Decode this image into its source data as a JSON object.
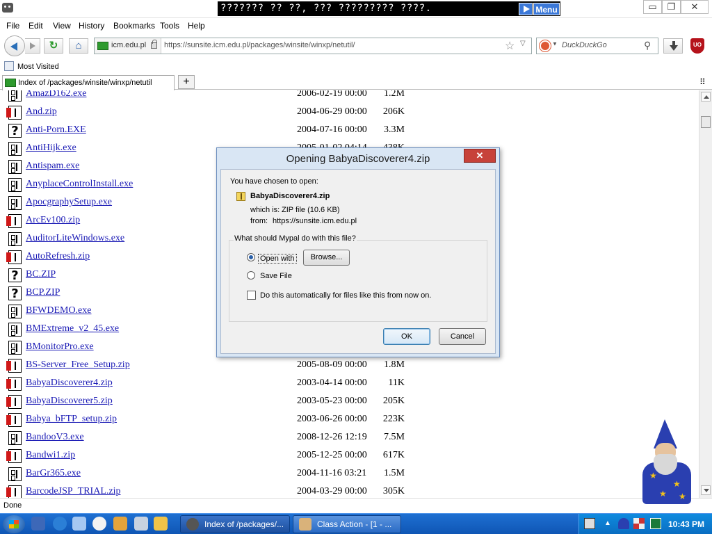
{
  "window": {
    "title": "??????? ?? ??, ??? ????????? ????.",
    "menu_button": "Menu",
    "min_glyph": "▭",
    "max_glyph": "❐",
    "close_glyph": "✕"
  },
  "menubar": {
    "items": [
      "File",
      "Edit",
      "View",
      "History",
      "Bookmarks",
      "Tools",
      "Help"
    ]
  },
  "navbar": {
    "site_domain": "icm.edu.pl",
    "url": "https://sunsite.icm.edu.pl/packages/winsite/winxp/netutil/",
    "search_placeholder": "DuckDuckGo",
    "reload_glyph": "↻",
    "home_glyph": "⌂",
    "star_glyph": "☆",
    "dropmarker_glyph": "▽",
    "search_go_glyph": "⚲",
    "ublock_label": "UO"
  },
  "bookmarks": {
    "most_visited": "Most Visited"
  },
  "tabs": {
    "active_title": "Index of /packages/winsite/winxp/netutil",
    "new_tab_glyph": "+",
    "list_glyph": "⠿"
  },
  "listing": {
    "files": [
      {
        "icon": "bin",
        "name": "AmazD162.exe",
        "date": "2006-02-19 00:00",
        "size": "1.2M"
      },
      {
        "icon": "zip",
        "name": "And.zip",
        "date": "2004-06-29 00:00",
        "size": "206K"
      },
      {
        "icon": "unk",
        "name": "Anti-Porn.EXE",
        "date": "2004-07-16 00:00",
        "size": "3.3M"
      },
      {
        "icon": "bin",
        "name": "AntiHijk.exe",
        "date": "2005-01-02 04:14",
        "size": "438K"
      },
      {
        "icon": "bin",
        "name": "Antispam.exe",
        "date": "",
        "size": ""
      },
      {
        "icon": "bin",
        "name": "AnyplaceControlInstall.exe",
        "date": "",
        "size": ""
      },
      {
        "icon": "bin",
        "name": "ApocgraphySetup.exe",
        "date": "",
        "size": ""
      },
      {
        "icon": "zip",
        "name": "ArcEv100.zip",
        "date": "",
        "size": ""
      },
      {
        "icon": "bin",
        "name": "AuditorLiteWindows.exe",
        "date": "",
        "size": ""
      },
      {
        "icon": "zip",
        "name": "AutoRefresh.zip",
        "date": "",
        "size": ""
      },
      {
        "icon": "unk",
        "name": "BC.ZIP",
        "date": "",
        "size": ""
      },
      {
        "icon": "unk",
        "name": "BCP.ZIP",
        "date": "",
        "size": ""
      },
      {
        "icon": "bin",
        "name": "BFWDEMO.exe",
        "date": "",
        "size": ""
      },
      {
        "icon": "bin",
        "name": "BMExtreme_v2_45.exe",
        "date": "",
        "size": ""
      },
      {
        "icon": "bin",
        "name": "BMonitorPro.exe",
        "date": "",
        "size": ""
      },
      {
        "icon": "zip",
        "name": "BS-Server_Free_Setup.zip",
        "date": "2005-08-09 00:00",
        "size": "1.8M"
      },
      {
        "icon": "zip",
        "name": "BabyaDiscoverer4.zip",
        "date": "2003-04-14 00:00",
        "size": "11K"
      },
      {
        "icon": "zip",
        "name": "BabyaDiscoverer5.zip",
        "date": "2003-05-23 00:00",
        "size": "205K"
      },
      {
        "icon": "zip",
        "name": "Babya_bFTP_setup.zip",
        "date": "2003-06-26 00:00",
        "size": "223K"
      },
      {
        "icon": "bin",
        "name": "BandooV3.exe",
        "date": "2008-12-26 12:19",
        "size": "7.5M"
      },
      {
        "icon": "zip",
        "name": "Bandwi1.zip",
        "date": "2005-12-25 00:00",
        "size": "617K"
      },
      {
        "icon": "bin",
        "name": "BarGr365.exe",
        "date": "2004-11-16 03:21",
        "size": "1.5M"
      },
      {
        "icon": "zip",
        "name": "BarcodeJSP_TRIAL.zip",
        "date": "2004-03-29 00:00",
        "size": "305K"
      }
    ]
  },
  "statusbar": {
    "text": "Done"
  },
  "dialog": {
    "title": "Opening BabyaDiscoverer4.zip",
    "close_glyph": "✕",
    "intro": "You have chosen to open:",
    "file_name": "BabyaDiscoverer4.zip",
    "which_is_label": "which is:",
    "which_is_value": "ZIP file (10.6 KB)",
    "from_label": "from:",
    "from_value": "https://sunsite.icm.edu.pl",
    "question": "What should Mypal do with this file?",
    "open_with_label": "Open with",
    "browse_label": "Browse...",
    "save_file_label": "Save File",
    "auto_label": "Do this automatically for files like this from now on.",
    "ok_label": "OK",
    "cancel_label": "Cancel"
  },
  "taskbar": {
    "tasks": [
      "Index of /packages/...",
      "Class Action - [1 - ..."
    ],
    "tray_up_glyph": "▲",
    "clock": "10:43 PM"
  }
}
